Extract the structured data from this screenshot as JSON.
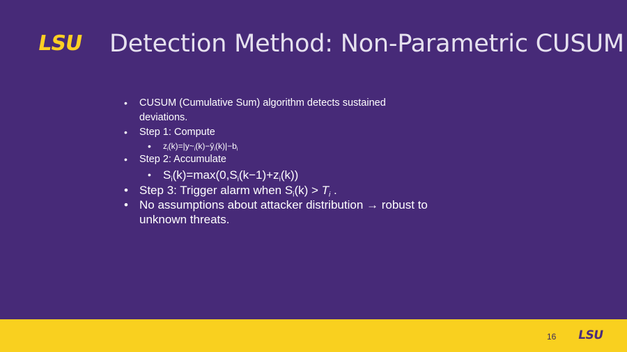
{
  "header": {
    "logo_text": "LSU",
    "title": "Detection Method: Non-Parametric CUSUM"
  },
  "bullets": {
    "b1_line1": "CUSUM (Cumulative Sum) algorithm detects sustained",
    "b1_line2": "deviations.",
    "b2": "Step 1: Compute",
    "b2_sub": {
      "a": "z",
      "a_sub": "i",
      "b": "(k)=|y",
      "c": "~",
      "c_sub": "i",
      "d": "(k)−ŷ",
      "d_sub": "i",
      "e": "(k)|−b",
      "e_sub": "i"
    },
    "b3": "Step 2: Accumulate",
    "b3_sub": {
      "a": "S",
      "a_sub": "i",
      "b": "(k)=max(0,S",
      "b_sub": "i",
      "c": "(k−1)+z",
      "c_sub": "i",
      "d": "(k))"
    },
    "b4": {
      "a": "Step 3: Trigger alarm when S",
      "a_sub": "i",
      "b": "(k) > ",
      "c": "T",
      "c_sub": "i",
      "d": " ."
    },
    "b5_line1": "No assumptions about attacker distribution → robust to",
    "b5_line2": "unknown threats."
  },
  "footer": {
    "page_number": "16",
    "logo_text": "LSU"
  },
  "colors": {
    "background": "#472a78",
    "gold": "#f9d01f",
    "purple": "#4b2c7c"
  }
}
